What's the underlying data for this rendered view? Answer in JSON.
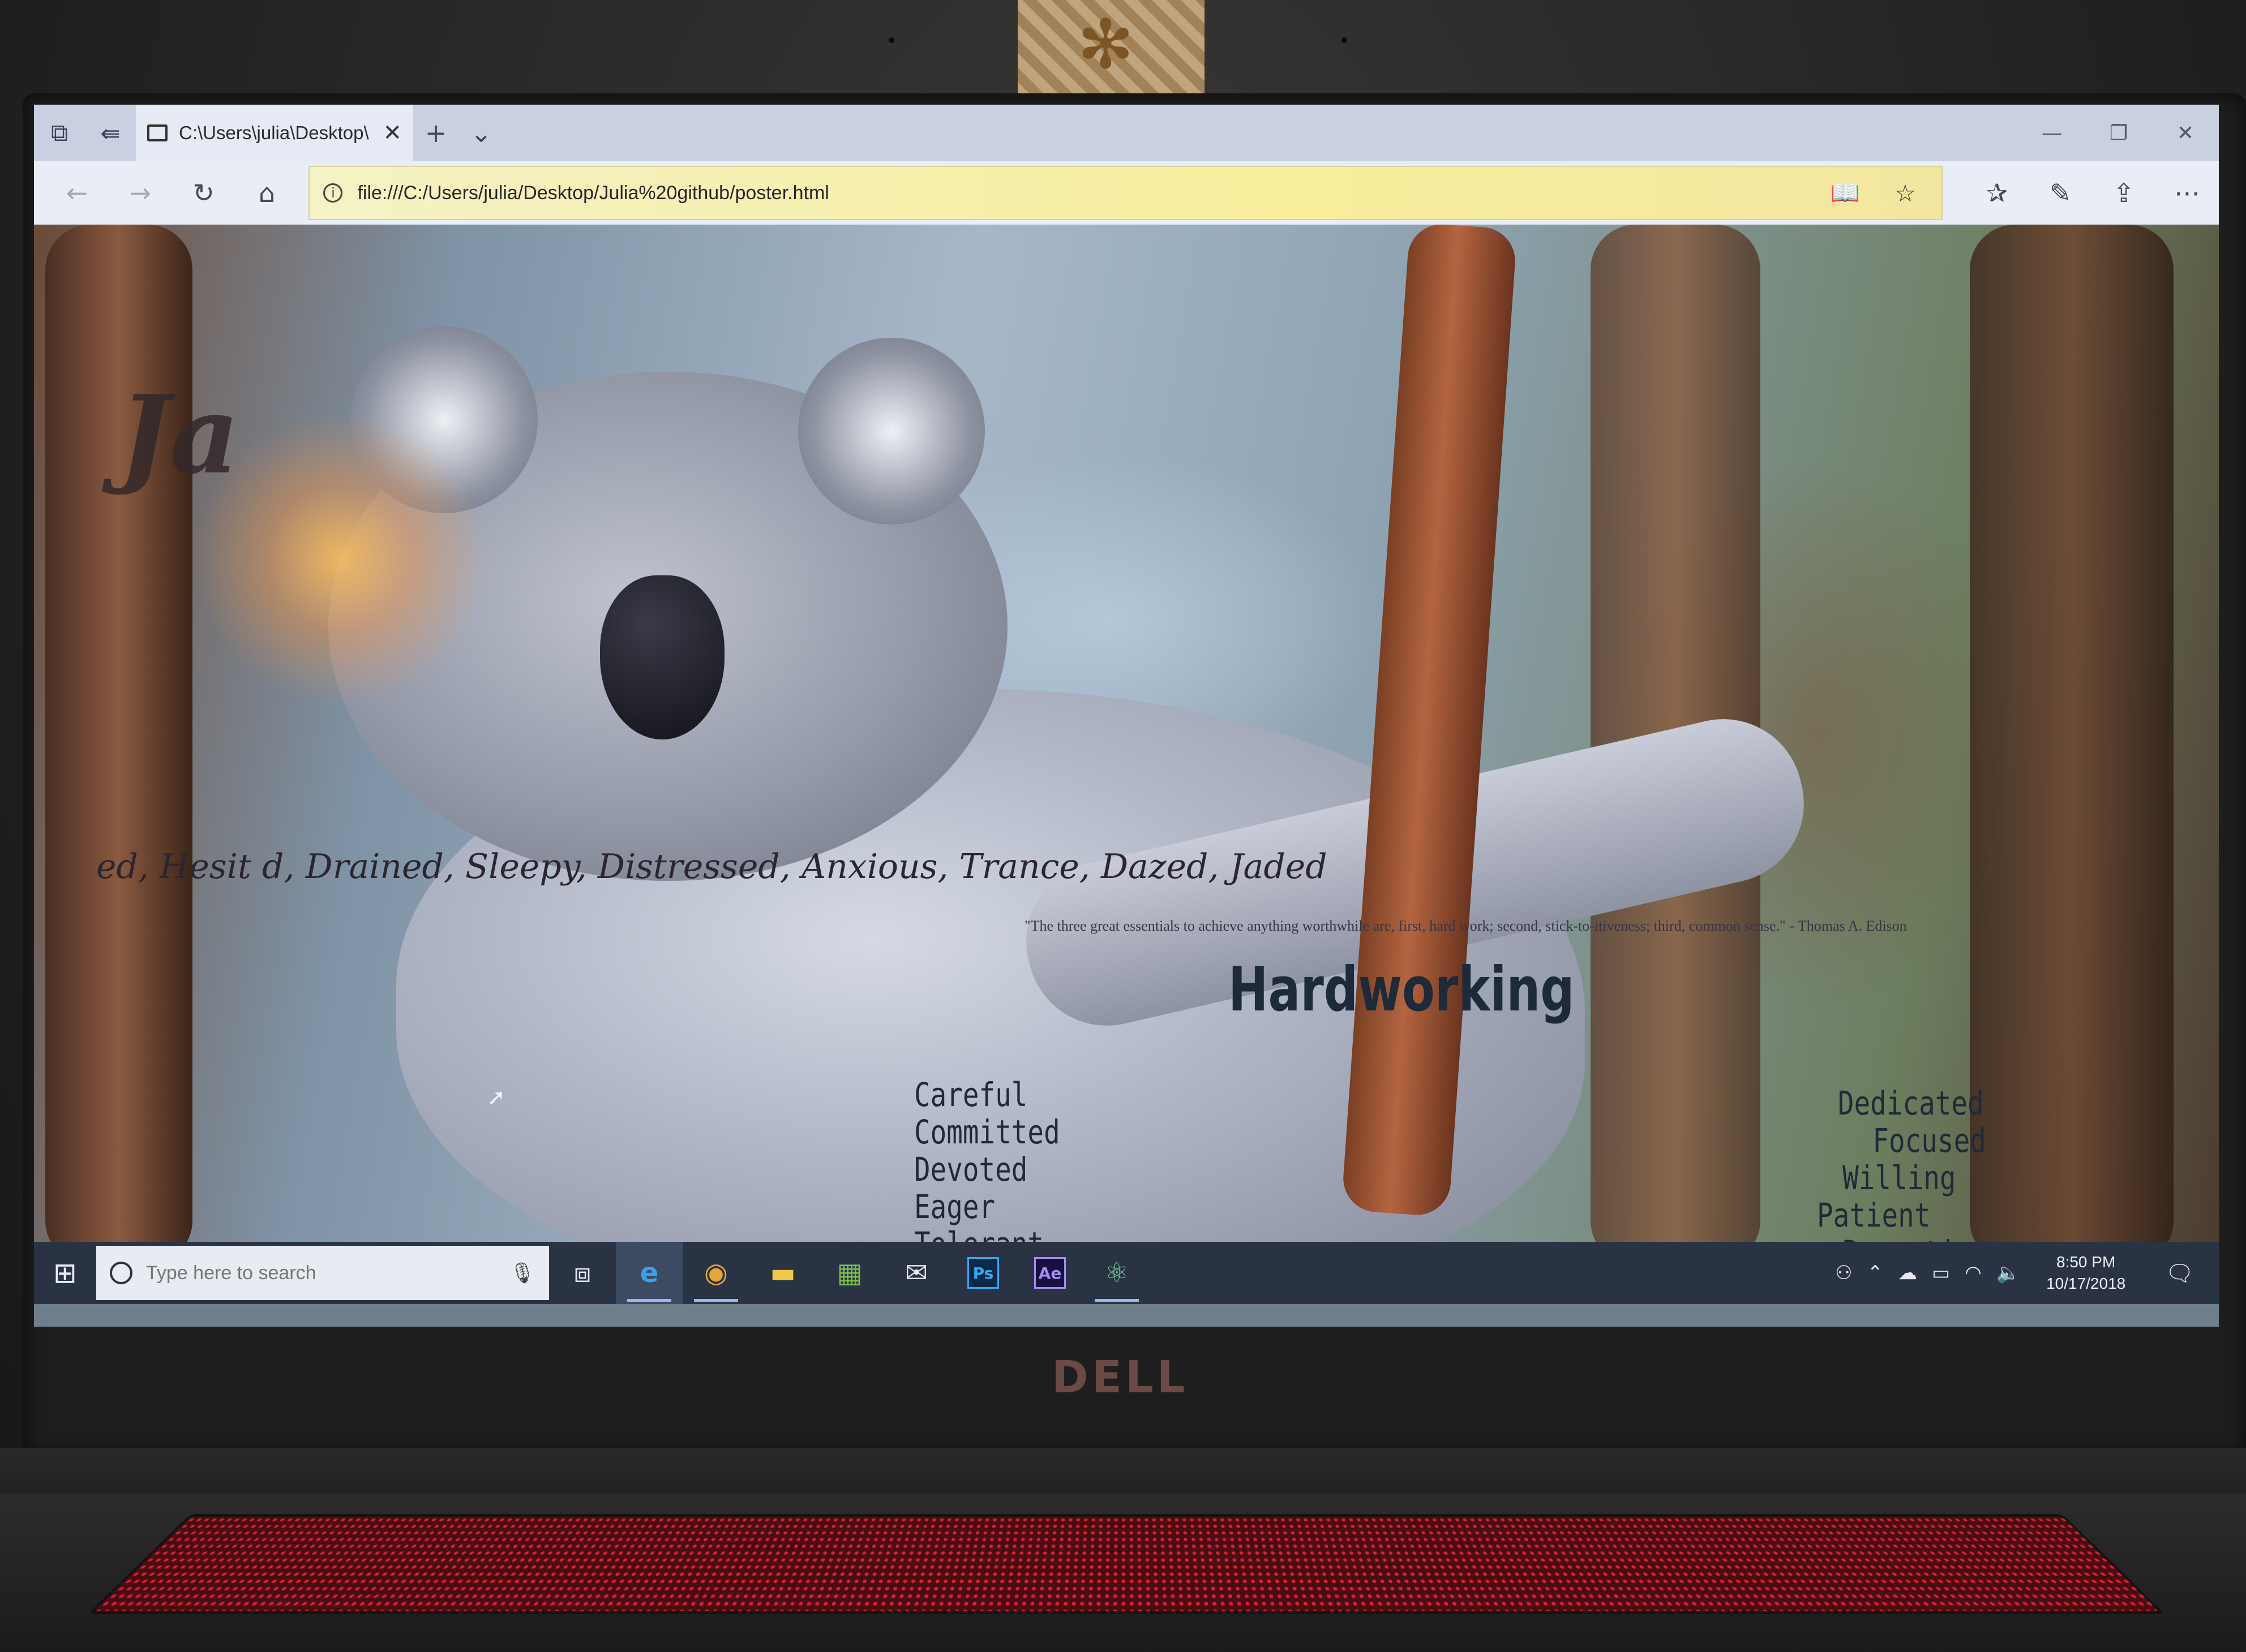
{
  "browser": {
    "tab_title": "C:\\Users\\julia\\Desktop\\",
    "url": "file:///C:/Users/julia/Desktop/Julia%20github/poster.html"
  },
  "icons": {
    "set_aside_tabs": "tabs-aside-icon",
    "show_tabs": "tabs-preview-icon",
    "back": "back-arrow-icon",
    "forward": "forward-arrow-icon",
    "refresh": "refresh-icon",
    "home": "home-icon",
    "reading_view": "reading-view-icon",
    "favorite": "star-icon",
    "favorites_hub": "favorites-icon",
    "notes": "pen-icon",
    "share": "share-icon",
    "more": "more-icon"
  },
  "poster": {
    "title_fragment": "Ja",
    "mood_line": "ed, Hesit        d, Drained, Sleepy, Distressed, Anxious, Trance, Dazed, Jaded",
    "quote": "\"The three great essentials to achieve anything worthwhile are, first, hard work; second, stick-to-itiveness; third, common sense.\" - Thomas A. Edison",
    "heading": "Hardworking",
    "left_words": [
      "Careful",
      "Committed",
      "Devoted",
      "Eager",
      "Tolerant"
    ],
    "right_words": [
      "Dedicated",
      "Focused",
      "Willing",
      "Patient",
      "Receptive"
    ]
  },
  "taskbar": {
    "search_placeholder": "Type here to search",
    "time": "8:50 PM",
    "date": "10/17/2018",
    "apps": [
      "task-view",
      "edge",
      "chrome",
      "file-explorer",
      "store",
      "mail",
      "photoshop",
      "after-effects",
      "atom"
    ],
    "ps_label": "Ps",
    "ae_label": "Ae"
  },
  "hardware": {
    "brand": "DELL"
  }
}
